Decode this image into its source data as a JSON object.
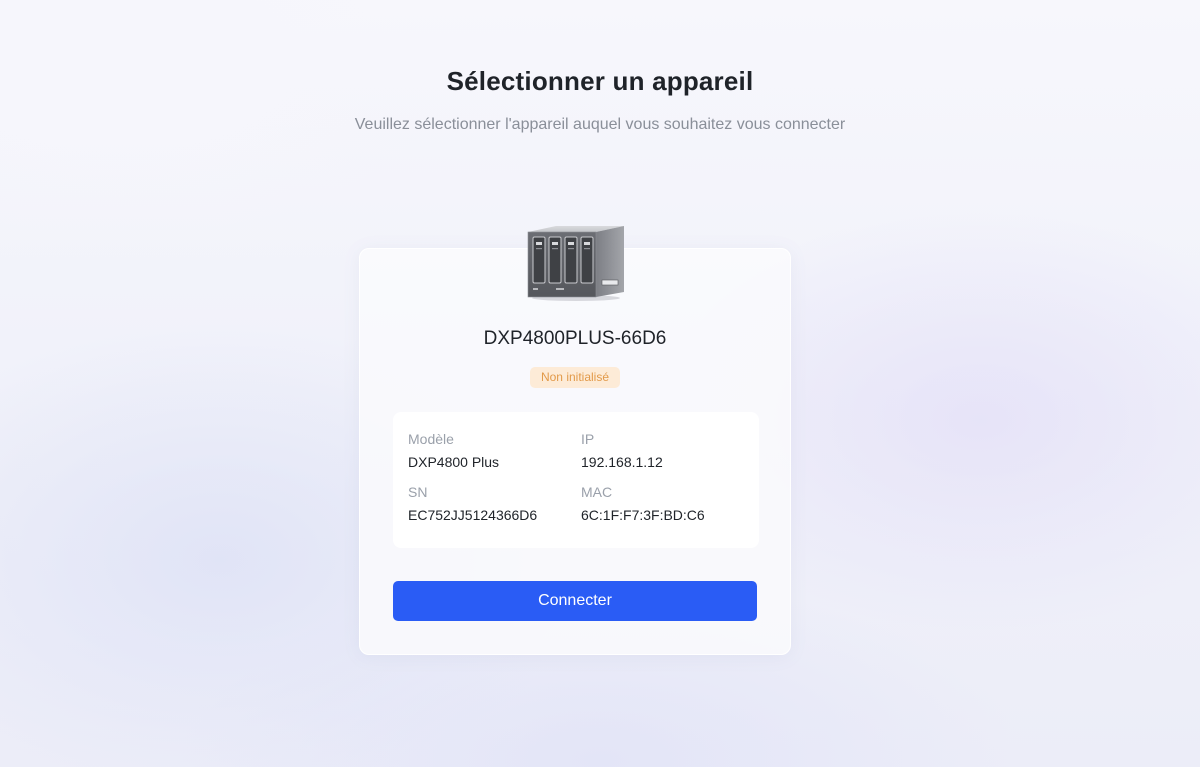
{
  "header": {
    "title": "Sélectionner un appareil",
    "subtitle": "Veuillez sélectionner l'appareil auquel vous souhaitez vous connecter"
  },
  "device": {
    "image_icon": "nas-4-bay-device-icon",
    "name": "DXP4800PLUS-66D6",
    "status": "Non initialisé",
    "info": {
      "model_label": "Modèle",
      "model_value": "DXP4800 Plus",
      "ip_label": "IP",
      "ip_value": "192.168.1.12",
      "sn_label": "SN",
      "sn_value": "EC752JJ5124366D6",
      "mac_label": "MAC",
      "mac_value": "6C:1F:F7:3F:BD:C6"
    }
  },
  "actions": {
    "connect_label": "Connecter"
  },
  "colors": {
    "primary": "#2a5cf5",
    "status_bg": "#fdebd7",
    "status_text": "#e29a4a"
  }
}
